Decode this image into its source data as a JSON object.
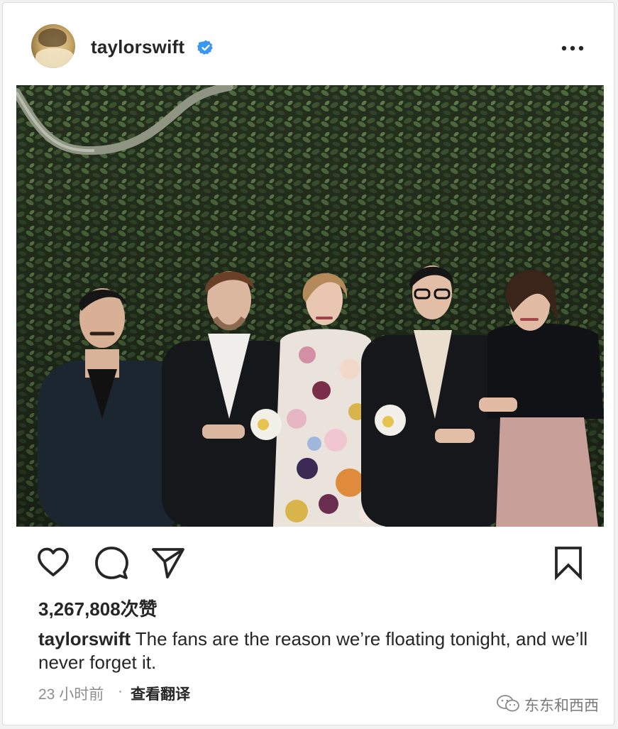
{
  "post": {
    "username": "taylorswift",
    "verified_icon": "verified-badge-icon",
    "more_icon": "more-options-icon",
    "photo_description_icon": "photo"
  },
  "actions": {
    "like_icon": "heart-icon",
    "comment_icon": "comment-bubble-icon",
    "share_icon": "paper-plane-icon",
    "save_icon": "bookmark-icon"
  },
  "likes": {
    "count": "3,267,808",
    "suffix": "次赞"
  },
  "caption": {
    "username": "taylorswift",
    "text": " The fans are the reason we’re floating tonight, and we’ll never forget it."
  },
  "meta": {
    "time": "23 小时前",
    "separator": "·",
    "translate": "查看翻译"
  },
  "watermark": {
    "text": "东东和西西"
  },
  "colors": {
    "verified_blue": "#3897f0",
    "text": "#262626",
    "muted": "#8e8e8e"
  }
}
